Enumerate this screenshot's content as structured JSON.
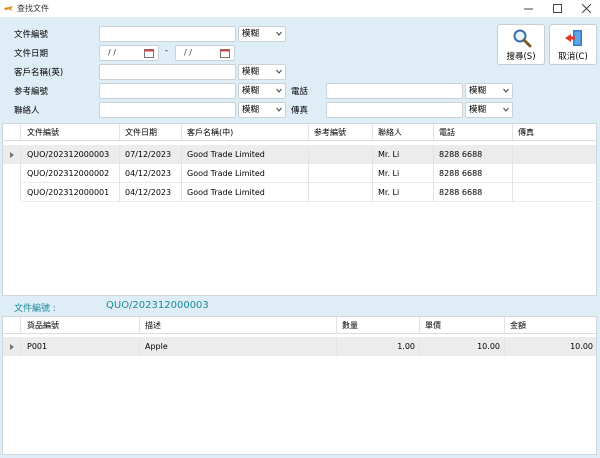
{
  "window": {
    "title": "查找文件",
    "minimize_icon": "minimize-icon",
    "maximize_icon": "maximize-icon",
    "close_icon": "close-icon"
  },
  "search": {
    "doc_no_label": "文件編號",
    "doc_no_value": "",
    "doc_no_mode": "模糊",
    "doc_date_label": "文件日期",
    "date_from": "/ /",
    "date_to": "/ /",
    "date_separator": "-",
    "customer_label": "客戶名稱(英)",
    "customer_value": "",
    "customer_mode": "模糊",
    "ref_label": "参考編號",
    "ref_value": "",
    "ref_mode": "模糊",
    "phone_label": "電話",
    "phone_value": "",
    "phone_mode": "模糊",
    "contact_label": "聯絡人",
    "contact_value": "",
    "contact_mode": "模糊",
    "fax_label": "傳真",
    "fax_value": "",
    "fax_mode": "模糊"
  },
  "buttons": {
    "search_label": "搜尋(S)",
    "cancel_label": "取消(C)",
    "search_icon": "magnifier-icon",
    "cancel_icon": "exit-door-icon"
  },
  "results": {
    "columns": [
      "文件編號",
      "文件日期",
      "客戶名稱(中)",
      "参考編號",
      "聯絡人",
      "電話",
      "傳真"
    ],
    "rows": [
      [
        "QUO/202312000003",
        "07/12/2023",
        "Good Trade Limited",
        "",
        "Mr. Li",
        "8288 6688",
        ""
      ],
      [
        "QUO/202312000002",
        "04/12/2023",
        "Good Trade Limited",
        "",
        "Mr. Li",
        "8288 6688",
        ""
      ],
      [
        "QUO/202312000001",
        "04/12/2023",
        "Good Trade Limited",
        "",
        "Mr. Li",
        "8288 6688",
        ""
      ]
    ]
  },
  "selected_doc": {
    "label": "文件編號 :",
    "value": "QUO/202312000003"
  },
  "details": {
    "columns": [
      "貨品編號",
      "描述",
      "數量",
      "單價",
      "金額"
    ],
    "rows": [
      [
        "P001",
        "Apple",
        "1.00",
        "10.00",
        "10.00"
      ]
    ]
  },
  "colors": {
    "background": "#dfedf6",
    "accent_text": "#1a8a9a",
    "selected_row": "#ececec"
  }
}
